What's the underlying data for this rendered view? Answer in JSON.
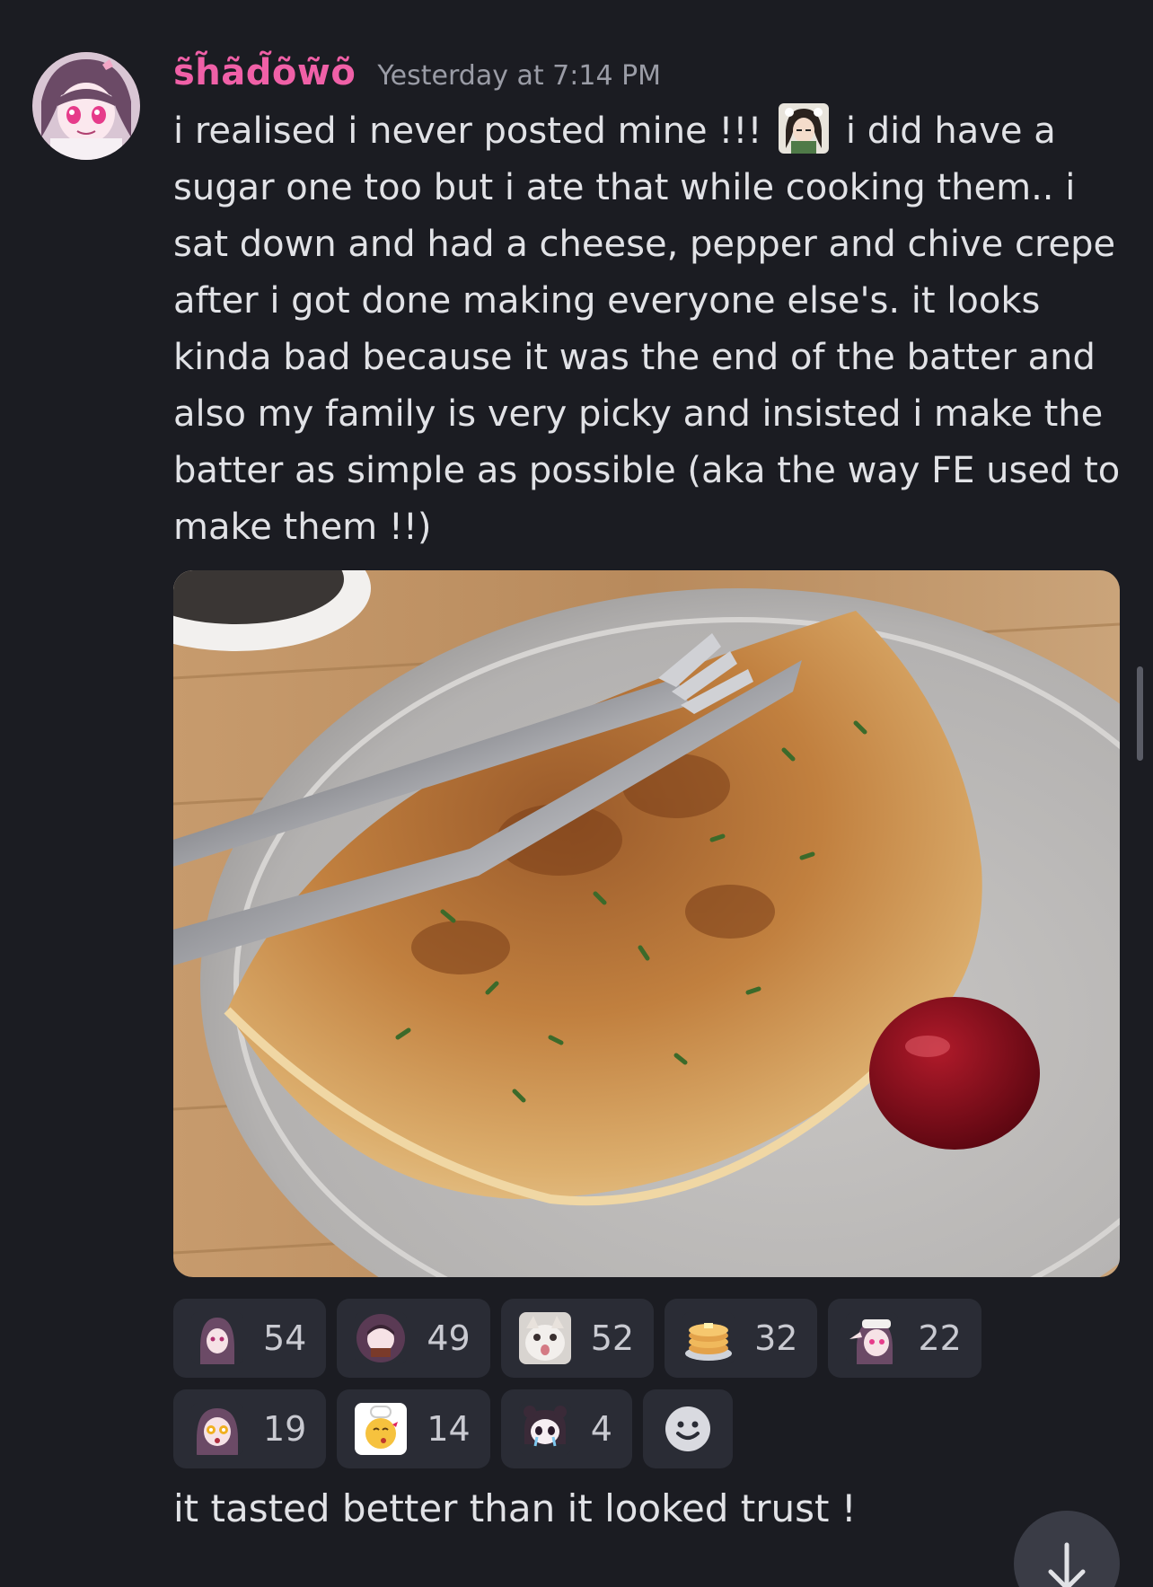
{
  "message": {
    "author": "s̃h̃ãd̃õw̃õ",
    "timestamp": "Yesterday at 7:14 PM",
    "text_before_emoji": "i realised i never posted mine !!! ",
    "text_after_emoji": " i did have a sugar one too but i ate that while cooking them.. i sat down and had a cheese, pepper and chive crepe after i got done making everyone else's. it looks kinda bad because it was the end of the batter and also my family is very picky and insisted i make the batter as simple as possible (aka the way FE used to make them !!)",
    "inline_emoji": "anime-girl-emoji"
  },
  "reactions": {
    "row1": [
      {
        "icon": "anime-girl-portrait-emoji",
        "count": "54"
      },
      {
        "icon": "anime-girl-holding-emoji",
        "count": "49"
      },
      {
        "icon": "cat-face-emoji",
        "count": "52"
      },
      {
        "icon": "pancakes-emoji",
        "count": "32"
      },
      {
        "icon": "anime-girl-saluting-emoji",
        "count": "22"
      }
    ],
    "row2": [
      {
        "icon": "anime-girl-shocked-emoji",
        "count": "19"
      },
      {
        "icon": "chef-kiss-emoji",
        "count": "14"
      },
      {
        "icon": "crying-chibi-emoji",
        "count": "4"
      }
    ],
    "add_reaction_icon": "smiley-add-reaction-icon"
  },
  "followup_message": {
    "text": "it tasted better than it looked trust !"
  },
  "colors": {
    "background": "#1b1c22",
    "username": "#f060a7",
    "reaction_bg": "#2a2c35"
  }
}
